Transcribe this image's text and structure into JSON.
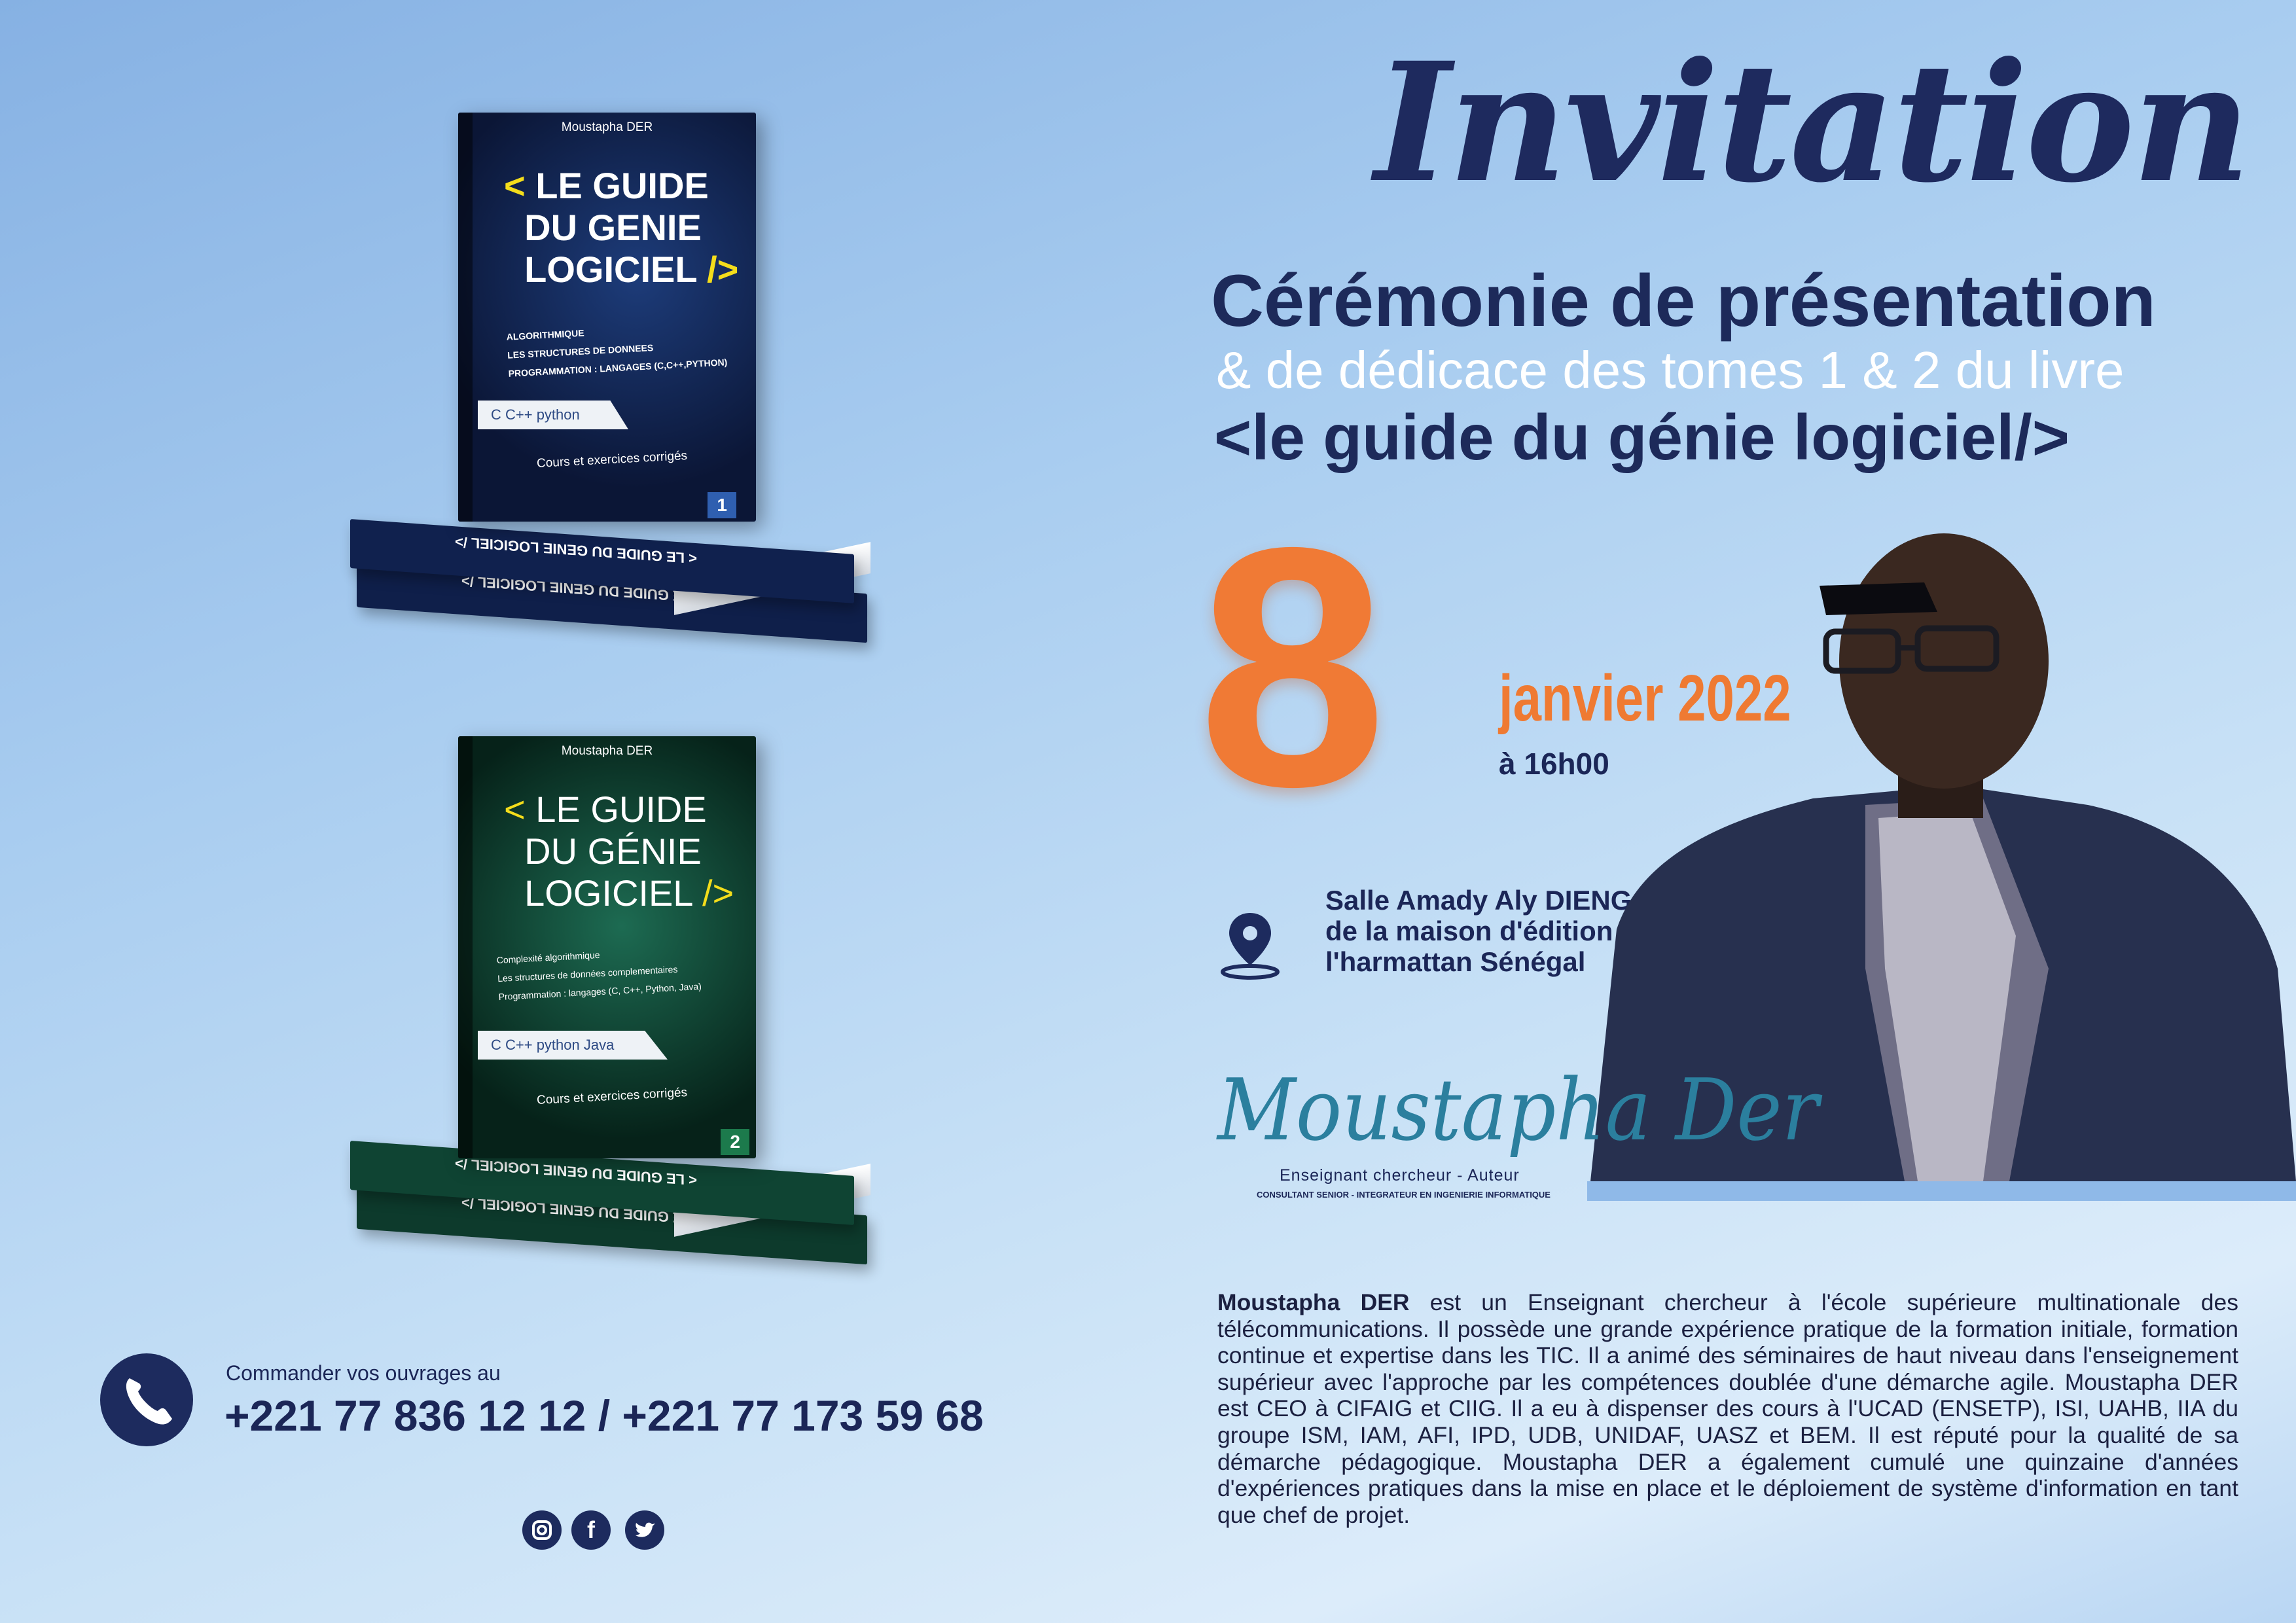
{
  "header": {
    "title": "Invitation",
    "line1": "Cérémonie de présentation",
    "line2": "& de dédicace des tomes 1 & 2  du livre",
    "line3": "<le guide du génie logiciel/>"
  },
  "event": {
    "day": "8",
    "month_year": "janvier 2022",
    "time": "à 16h00",
    "venue": [
      "Salle Amady Aly DIENG",
      "de la maison d'édition",
      "l'harmattan Sénégal"
    ]
  },
  "author": {
    "signature": "Moustapha Der",
    "role": "Enseignant chercheur - Auteur",
    "caption": "CONSULTANT SENIOR - INTEGRATEUR EN INGENIERIE INFORMATIQUE",
    "bio_name": "Moustapha DER",
    "bio": " est un Enseignant chercheur à l'école supérieure multinationale des télécommunications. Il possède une grande expérience pratique de la formation initiale, formation continue et expertise dans les TIC. Il a animé des séminaires de haut niveau dans l'enseignement supérieur avec l'approche par les compétences doublée d'une démarche agile. Moustapha DER est CEO à CIFAIG et CIIG. Il a eu à dispenser des cours à l'UCAD (ENSETP), ISI, UAHB, IIA du groupe ISM, IAM, AFI, IPD, UDB, UNIDAF, UASZ et BEM. Il est réputé pour la qualité de sa démarche pédagogique. Moustapha DER a également cumulé une quinzaine d'années d'expériences pratiques dans la mise en place et le déploiement de système d'information en tant que chef de projet."
  },
  "contact": {
    "label": "Commander vos ouvrages au",
    "numbers": "+221 77 836 12 12 / +221 77 173 59 68",
    "social": [
      "instagram-icon",
      "facebook-icon",
      "twitter-icon"
    ]
  },
  "books": [
    {
      "author": "Moustapha DER",
      "title_lines": [
        "LE GUIDE",
        "DU GENIE",
        "LOGICIEL"
      ],
      "open": "<",
      "close": "/>",
      "bullets": [
        "ALGORITHMIQUE",
        "LES STRUCTURES DE DONNEES",
        "PROGRAMMATION : LANGAGES (C,C++,PYTHON)"
      ],
      "langs": "C  C++  python",
      "subtitle": "Cours et exercices corrigés",
      "tome": "1",
      "spine": "< LE GUIDE DU GENIE LOGICIEL />",
      "color": "#0f1f4a"
    },
    {
      "author": "Moustapha DER",
      "title_lines": [
        "LE GUIDE",
        "DU GÉNIE",
        "LOGICIEL"
      ],
      "open": "<",
      "close": "/>",
      "bullets": [
        "Complexité algorithmique",
        "Les structures de données complementaires",
        "Programmation : langages (C, C++, Python, Java)"
      ],
      "langs": "C  C++  python  Java",
      "subtitle": "Cours et exercices corrigés",
      "tome": "2",
      "spine": "< LE GUIDE DU GENIE LOGICIEL />",
      "color": "#0d3a2c"
    }
  ],
  "colors": {
    "navy": "#1b2657",
    "orange": "#f07a35",
    "signature": "#2b7f9e"
  }
}
